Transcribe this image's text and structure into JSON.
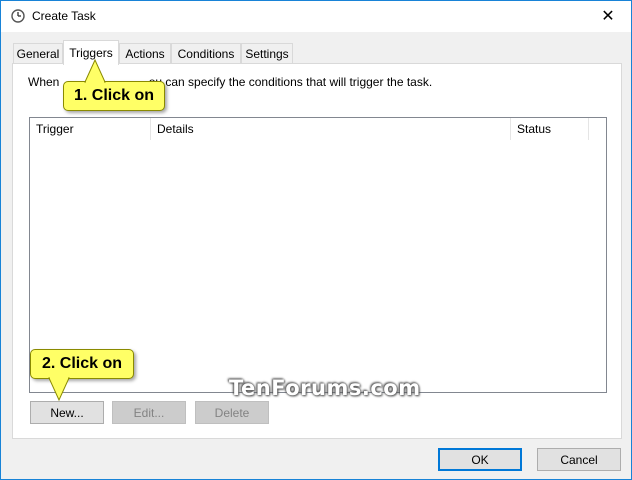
{
  "window": {
    "title": "Create Task",
    "close_glyph": "✕",
    "icon": "task-scheduler-icon"
  },
  "tabs": [
    {
      "label": "General",
      "active": false
    },
    {
      "label": "Triggers",
      "active": true
    },
    {
      "label": "Actions",
      "active": false
    },
    {
      "label": "Conditions",
      "active": false
    },
    {
      "label": "Settings",
      "active": false
    }
  ],
  "triggers_panel": {
    "description_prefix": "When ",
    "description_suffix": "ou can specify the conditions that will trigger the task.",
    "columns": [
      "Trigger",
      "Details",
      "Status"
    ],
    "rows": [],
    "buttons": {
      "new": "New...",
      "edit": "Edit...",
      "delete": "Delete"
    }
  },
  "footer": {
    "ok": "OK",
    "cancel": "Cancel"
  },
  "annotations": {
    "callout1": "1. Click on",
    "callout2": "2. Click on",
    "color": "#ffff66"
  },
  "watermark": "TenForums.com"
}
